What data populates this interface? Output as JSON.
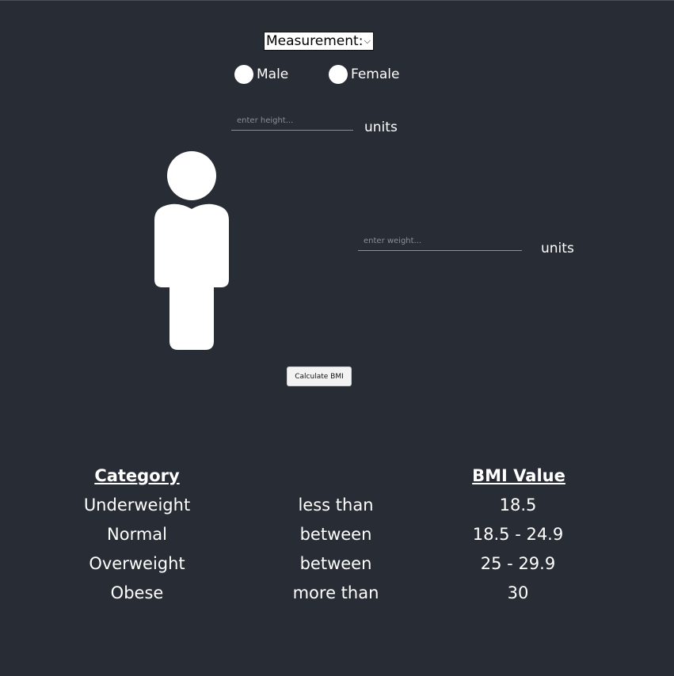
{
  "measurement": {
    "selected": "Measurement:"
  },
  "gender": {
    "male_label": "Male",
    "female_label": "Female"
  },
  "height": {
    "placeholder": "enter height...",
    "units": "units"
  },
  "weight": {
    "placeholder": "enter weight...",
    "units": "units"
  },
  "calculate": {
    "label": "Calculate BMI"
  },
  "table": {
    "headers": {
      "category": "Category",
      "bmi_value": "BMI Value"
    },
    "rows": [
      {
        "category": "Underweight",
        "relation": "less than",
        "value": "18.5"
      },
      {
        "category": "Normal",
        "relation": "between",
        "value": "18.5 - 24.9"
      },
      {
        "category": "Overweight",
        "relation": "between",
        "value": "25 - 29.9"
      },
      {
        "category": "Obese",
        "relation": "more than",
        "value": "30"
      }
    ]
  },
  "icons": {
    "person": "person-icon",
    "dropdown": "chevron-down-icon"
  },
  "colors": {
    "background": "#282c34",
    "foreground": "#ffffff"
  }
}
